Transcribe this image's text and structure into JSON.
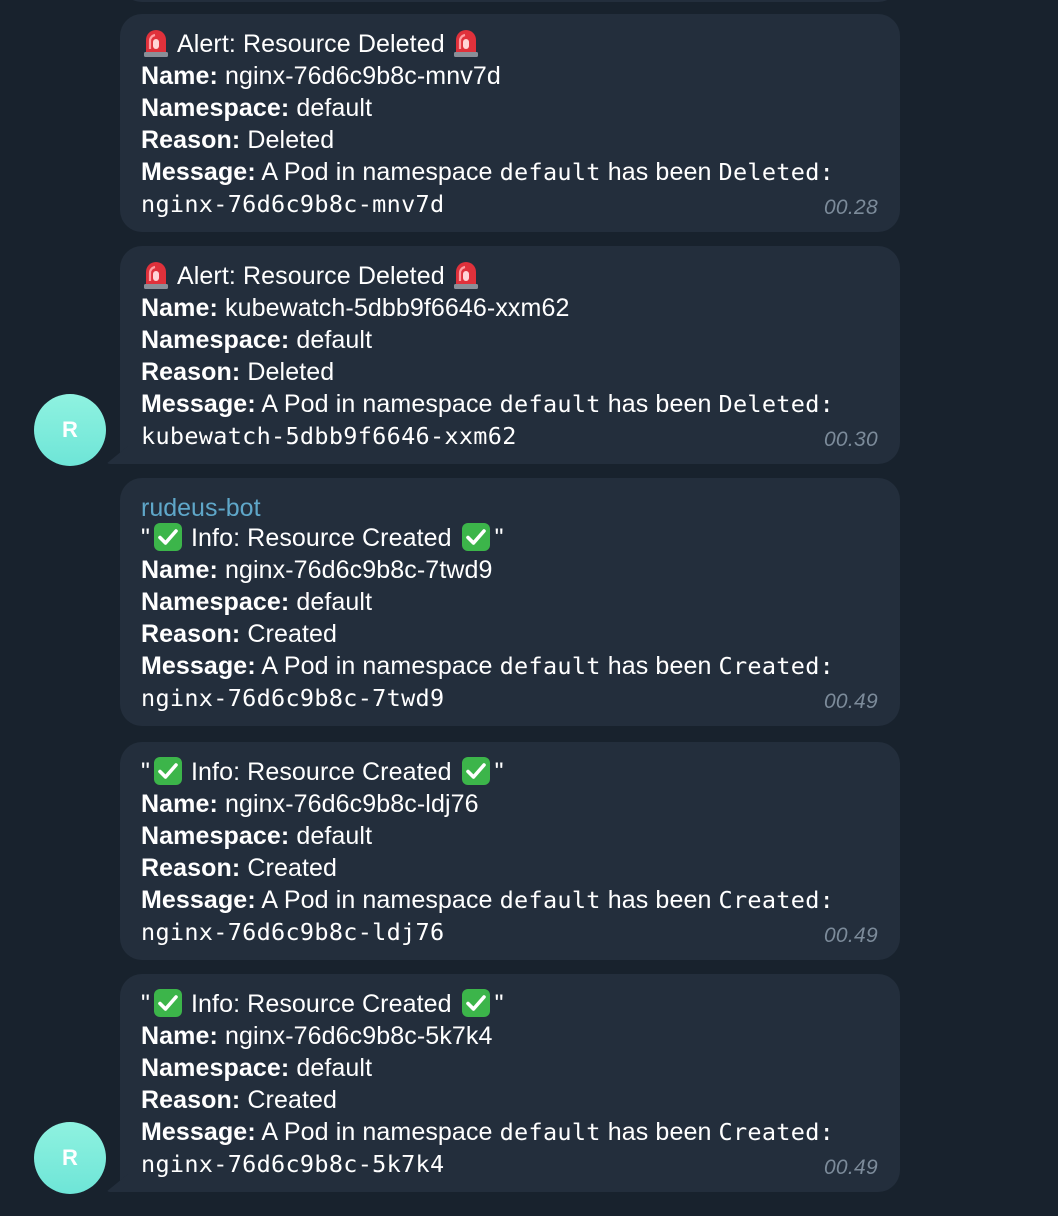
{
  "messages": [
    {
      "title": "Alert: Resource Deleted",
      "name_label": "Name:",
      "name": "nginx-76d6c9b8c-mnv7d",
      "namespace_label": "Namespace:",
      "namespace": "default",
      "reason_label": "Reason:",
      "reason": "Deleted",
      "message_label": "Message:",
      "message_prefix": "A Pod in namespace",
      "message_ns": "default",
      "message_mid": "has been",
      "message_action": "Deleted:",
      "resource": "nginx-76d6c9b8c-mnv7d",
      "time": "00.28"
    },
    {
      "title": "Alert: Resource Deleted",
      "name_label": "Name:",
      "name": "kubewatch-5dbb9f6646-xxm62",
      "namespace_label": "Namespace:",
      "namespace": "default",
      "reason_label": "Reason:",
      "reason": "Deleted",
      "message_label": "Message:",
      "message_prefix": "A Pod in namespace",
      "message_ns": "default",
      "message_mid": "has been",
      "message_action": "Deleted:",
      "resource": "kubewatch-5dbb9f6646-xxm62",
      "time": "00.30",
      "avatar": "R"
    },
    {
      "sender": "rudeus-bot",
      "title": "Info: Resource Created",
      "name_label": "Name:",
      "name": "nginx-76d6c9b8c-7twd9",
      "namespace_label": "Namespace:",
      "namespace": "default",
      "reason_label": "Reason:",
      "reason": "Created",
      "message_label": "Message:",
      "message_prefix": "A Pod in namespace",
      "message_ns": "default",
      "message_mid": "has been",
      "message_action": "Created:",
      "resource": "nginx-76d6c9b8c-7twd9",
      "time": "00.49"
    },
    {
      "title": "Info: Resource Created",
      "name_label": "Name:",
      "name": "nginx-76d6c9b8c-ldj76",
      "namespace_label": "Namespace:",
      "namespace": "default",
      "reason_label": "Reason:",
      "reason": "Created",
      "message_label": "Message:",
      "message_prefix": "A Pod in namespace",
      "message_ns": "default",
      "message_mid": "has been",
      "message_action": "Created:",
      "resource": "nginx-76d6c9b8c-ldj76",
      "time": "00.49"
    },
    {
      "title": "Info: Resource Created",
      "name_label": "Name:",
      "name": "nginx-76d6c9b8c-5k7k4",
      "namespace_label": "Namespace:",
      "namespace": "default",
      "reason_label": "Reason:",
      "reason": "Created",
      "message_label": "Message:",
      "message_prefix": "A Pod in namespace",
      "message_ns": "default",
      "message_mid": "has been",
      "message_action": "Created:",
      "resource": "nginx-76d6c9b8c-5k7k4",
      "time": "00.49",
      "avatar": "R"
    }
  ],
  "quote_char": "\"",
  "icons": {
    "alert": "siren-icon",
    "info": "check-mark-icon"
  },
  "colors": {
    "background": "#18222d",
    "bubble": "#232e3c",
    "sender": "#5fa7c9",
    "time": "#7c8b9a",
    "avatar": "#7eeadb"
  }
}
